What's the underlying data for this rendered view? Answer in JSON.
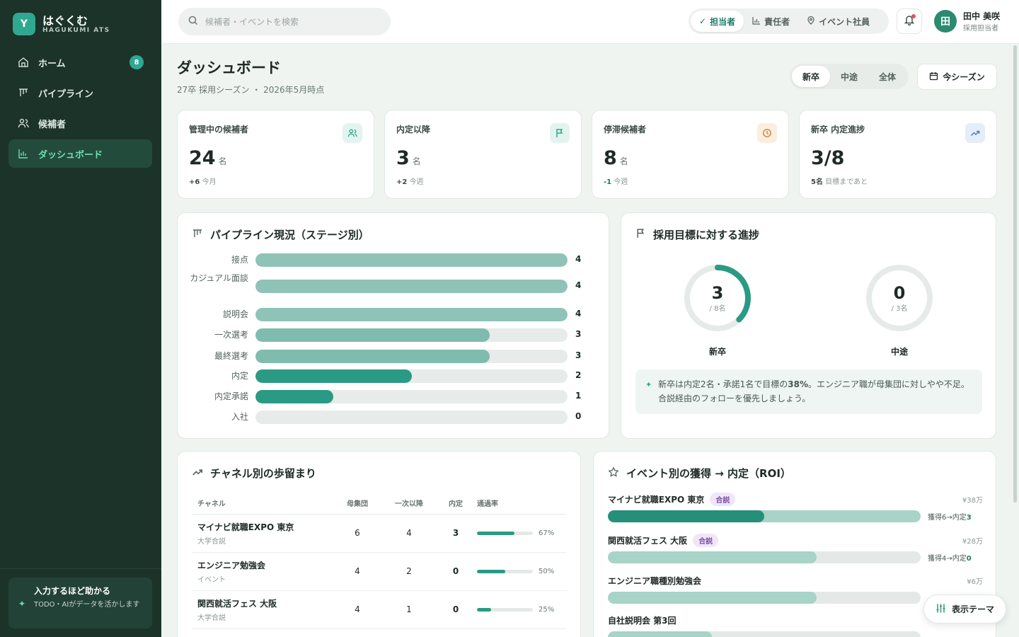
{
  "brand": {
    "name": "はぐくむ",
    "sub": "HAGUKUMI ATS",
    "logo": "Y"
  },
  "nav": [
    {
      "label": "ホーム",
      "icon": "home-icon",
      "badge": "8"
    },
    {
      "label": "パイプライン",
      "icon": "pipeline-icon"
    },
    {
      "label": "候補者",
      "icon": "users-icon"
    },
    {
      "label": "ダッシュボード",
      "icon": "chart-icon",
      "active": true
    }
  ],
  "promo": {
    "title": "入力するほど助かる",
    "text": "TODO・AIがデータを活かします"
  },
  "search": {
    "placeholder": "候補者・イベントを検索"
  },
  "roles": [
    "担当者",
    "責任者",
    "イベント社員"
  ],
  "user": {
    "avatar": "田",
    "name": "田中 美咲",
    "role": "採用担当者"
  },
  "header": {
    "title": "ダッシュボード",
    "subtitle": "27卒 採用シーズン ・ 2026年5月時点",
    "types": [
      "新卒",
      "中途",
      "全体"
    ],
    "season": "今シーズン"
  },
  "stats": [
    {
      "label": "管理中の候補者",
      "value": "24",
      "unit": "名",
      "delta": "+6",
      "delta_note": "今月",
      "icon": "users-icon",
      "icon_color": "#2fa892",
      "icon_bg": "#e3f4ee"
    },
    {
      "label": "内定以降",
      "value": "3",
      "unit": "名",
      "delta": "+2",
      "delta_note": "今週",
      "icon": "flag-icon",
      "icon_color": "#2fa892",
      "icon_bg": "#e3f4ee"
    },
    {
      "label": "停滞候補者",
      "value": "8",
      "unit": "名",
      "delta": "-1",
      "delta_note": "今週",
      "icon": "clock-icon",
      "icon_color": "#c9853a",
      "icon_bg": "#fbeedf"
    },
    {
      "label": "新卒 内定進捗",
      "value": "3/8",
      "unit": "",
      "delta": "5名",
      "delta_note": "目標まであと",
      "icon": "trend-icon",
      "icon_color": "#4f7fc6",
      "icon_bg": "#e4edf9"
    }
  ],
  "pipeline": {
    "title": "パイプライン現況（ステージ別）",
    "max": 4,
    "stages": [
      {
        "label": "接点",
        "value": 4,
        "color": "#8fc3b7"
      },
      {
        "label": "カジュアル面談",
        "value": 4,
        "color": "#8fc3b7"
      },
      {
        "label": "説明会",
        "value": 4,
        "color": "#8fc3b7"
      },
      {
        "label": "一次選考",
        "value": 3,
        "color": "#7fbcae"
      },
      {
        "label": "最終選考",
        "value": 3,
        "color": "#7fbcae"
      },
      {
        "label": "内定",
        "value": 2,
        "color": "#2b9a85"
      },
      {
        "label": "内定承諾",
        "value": 1,
        "color": "#2b9a85"
      },
      {
        "label": "入社",
        "value": 0,
        "color": "#2b9a85"
      }
    ]
  },
  "progress": {
    "title": "採用目標に対する進捗",
    "rings": [
      {
        "label": "新卒",
        "value": 3,
        "target": 8,
        "den": "/ 8名"
      },
      {
        "label": "中途",
        "value": 0,
        "target": 3,
        "den": "/ 3名"
      }
    ],
    "insight_pre": "新卒は内定2名・承諾1名で目標の",
    "insight_pct": "38%",
    "insight_post": "。エンジニア職が母集団に対しやや不足。合説経由のフォローを優先しましょう。"
  },
  "channels": {
    "title": "チャネル別の歩留まり",
    "columns": [
      "チャネル",
      "母集団",
      "一次以降",
      "内定",
      "通過率"
    ],
    "rows": [
      {
        "name": "マイナビ就職EXPO 東京",
        "kind": "大学合説",
        "pool": 6,
        "first": 4,
        "offer": 3,
        "rate": 0.67,
        "rate_label": "67%"
      },
      {
        "name": "エンジニア勉強会",
        "kind": "イベント",
        "pool": 4,
        "first": 2,
        "offer": 0,
        "rate": 0.5,
        "rate_label": "50%"
      },
      {
        "name": "関西就活フェス 大阪",
        "kind": "大学合説",
        "pool": 4,
        "first": 1,
        "offer": 0,
        "rate": 0.25,
        "rate_label": "25%"
      }
    ]
  },
  "events": {
    "title": "イベント別の獲得 → 内定（ROI）",
    "max": 6,
    "rows": [
      {
        "name": "マイナビ就職EXPO 東京",
        "tag": "合説",
        "cost": "¥38万",
        "acquired": 6,
        "offers": 3,
        "acq_label": "獲得6→内定",
        "offer_label": "3"
      },
      {
        "name": "関西就活フェス 大阪",
        "tag": "合説",
        "cost": "¥28万",
        "acquired": 4,
        "offers": 0,
        "acq_label": "獲得4→内定",
        "offer_label": "0"
      },
      {
        "name": "エンジニア職種別勉強会",
        "tag": "",
        "cost": "¥6万",
        "acquired": 4,
        "offers": 0,
        "acq_label": "",
        "offer_label": ""
      },
      {
        "name": "自社説明会 第3回",
        "tag": "",
        "cost": "",
        "acquired": 2,
        "offers": 0,
        "acq_label": "",
        "offer_label": ""
      }
    ]
  },
  "theme_button": "表示テーマ"
}
